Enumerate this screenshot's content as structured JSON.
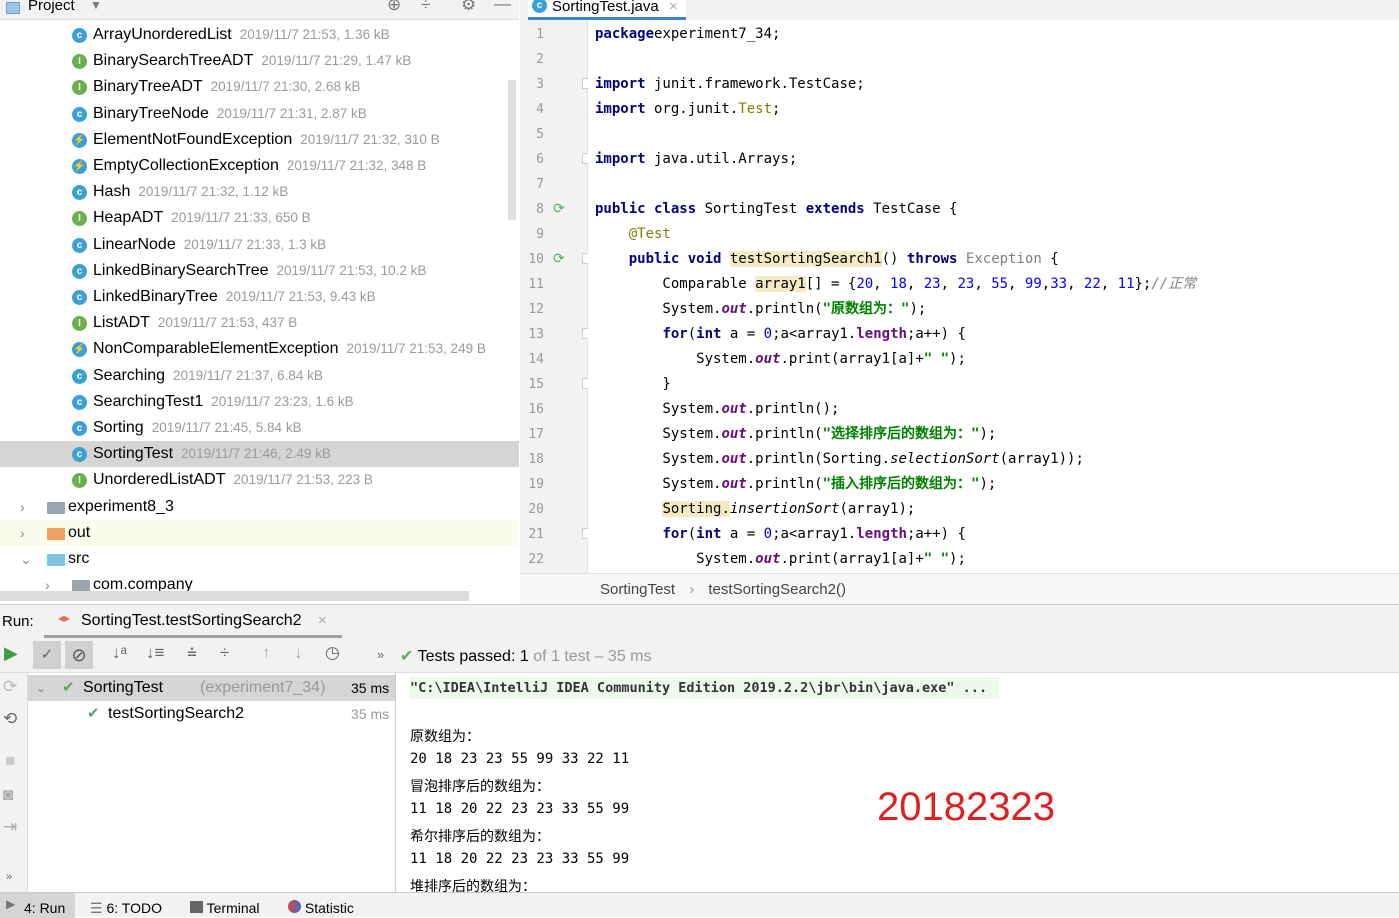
{
  "project": {
    "title": "Project",
    "files": [
      {
        "name": "ArrayUnorderedList",
        "meta": "2019/11/7 21:53, 1.36 kB",
        "type": "class"
      },
      {
        "name": "BinarySearchTreeADT",
        "meta": "2019/11/7 21:29, 1.47 kB",
        "type": "interface"
      },
      {
        "name": "BinaryTreeADT",
        "meta": "2019/11/7 21:30, 2.68 kB",
        "type": "interface"
      },
      {
        "name": "BinaryTreeNode",
        "meta": "2019/11/7 21:31, 2.87 kB",
        "type": "class"
      },
      {
        "name": "ElementNotFoundException",
        "meta": "2019/11/7 21:32, 310 B",
        "type": "exception"
      },
      {
        "name": "EmptyCollectionException",
        "meta": "2019/11/7 21:32, 348 B",
        "type": "exception"
      },
      {
        "name": "Hash",
        "meta": "2019/11/7 21:32, 1.12 kB",
        "type": "class"
      },
      {
        "name": "HeapADT",
        "meta": "2019/11/7 21:33, 650 B",
        "type": "interface"
      },
      {
        "name": "LinearNode",
        "meta": "2019/11/7 21:33, 1.3 kB",
        "type": "class"
      },
      {
        "name": "LinkedBinarySearchTree",
        "meta": "2019/11/7 21:53, 10.2 kB",
        "type": "class"
      },
      {
        "name": "LinkedBinaryTree",
        "meta": "2019/11/7 21:53, 9.43 kB",
        "type": "class"
      },
      {
        "name": "ListADT",
        "meta": "2019/11/7 21:53, 437 B",
        "type": "interface"
      },
      {
        "name": "NonComparableElementException",
        "meta": "2019/11/7 21:53, 249 B",
        "type": "exception"
      },
      {
        "name": "Searching",
        "meta": "2019/11/7 21:37, 6.84 kB",
        "type": "class"
      },
      {
        "name": "SearchingTest1",
        "meta": "2019/11/7 23:23, 1.6 kB",
        "type": "test"
      },
      {
        "name": "Sorting",
        "meta": "2019/11/7 21:45, 5.84 kB",
        "type": "class"
      },
      {
        "name": "SortingTest",
        "meta": "2019/11/7 21:46, 2.49 kB",
        "type": "test",
        "selected": true
      },
      {
        "name": "UnorderedListADT",
        "meta": "2019/11/7 21:53, 223 B",
        "type": "interface"
      }
    ],
    "folders": [
      {
        "name": "experiment8_3",
        "color": "#9aa7b0",
        "expanded": false
      },
      {
        "name": "out",
        "color": "#f0a060",
        "expanded": false
      },
      {
        "name": "src",
        "color": "#7ec3e6",
        "expanded": true
      },
      {
        "name": "com.company",
        "color": "#9aa7b0",
        "expanded": false
      }
    ]
  },
  "editor": {
    "tab": "SortingTest.java",
    "lines": [
      [
        [
          "kw",
          "package"
        ],
        [
          "",
          "experiment7_34;"
        ]
      ],
      [],
      [
        [
          "kw",
          "import"
        ],
        [
          "",
          " junit.framework.TestCase;"
        ]
      ],
      [
        [
          "kw",
          "import"
        ],
        [
          "",
          " org.junit."
        ],
        [
          "ann",
          "Test"
        ],
        [
          "",
          ";"
        ]
      ],
      [],
      [
        [
          "kw",
          "import"
        ],
        [
          "",
          " java.util.Arrays;"
        ]
      ],
      [],
      [
        [
          "kw",
          "public class"
        ],
        [
          "",
          " SortingTest "
        ],
        [
          "kw",
          "extends"
        ],
        [
          "",
          " TestCase {"
        ]
      ],
      [
        [
          "",
          "    "
        ],
        [
          "ann",
          "@Test"
        ]
      ],
      [
        [
          "",
          "    "
        ],
        [
          "kw",
          "public void"
        ],
        [
          "",
          " "
        ],
        [
          "hlb",
          "testSortingSearch1"
        ],
        [
          "",
          "() "
        ],
        [
          "kw",
          "throws"
        ],
        [
          "",
          " "
        ],
        [
          "gr",
          "Exception"
        ],
        [
          "",
          " {"
        ]
      ],
      [
        [
          "",
          "        Comparable "
        ],
        [
          "hlb",
          "array1"
        ],
        [
          "",
          "[] = {"
        ],
        [
          "num",
          "20"
        ],
        [
          "",
          ", "
        ],
        [
          "num",
          "18"
        ],
        [
          "",
          ", "
        ],
        [
          "num",
          "23"
        ],
        [
          "",
          ", "
        ],
        [
          "num",
          "23"
        ],
        [
          "",
          ", "
        ],
        [
          "num",
          "55"
        ],
        [
          "",
          ", "
        ],
        [
          "num",
          "99"
        ],
        [
          "",
          ","
        ],
        [
          "num",
          "33"
        ],
        [
          "",
          ", "
        ],
        [
          "num",
          "22"
        ],
        [
          "",
          ", "
        ],
        [
          "num",
          "11"
        ],
        [
          "",
          "};"
        ],
        [
          "cmt",
          "//正常"
        ]
      ],
      [
        [
          "",
          "        System."
        ],
        [
          "fld",
          "out"
        ],
        [
          "",
          ".println("
        ],
        [
          "str",
          "\"原数组为：\""
        ],
        [
          "",
          ");"
        ]
      ],
      [
        [
          "",
          "        "
        ],
        [
          "kw",
          "for"
        ],
        [
          "",
          "("
        ],
        [
          "kw",
          "int"
        ],
        [
          "",
          " a = "
        ],
        [
          "num",
          "0"
        ],
        [
          "",
          ";a<array1."
        ],
        [
          "lenf",
          "length"
        ],
        [
          "",
          ";a++) {"
        ]
      ],
      [
        [
          "",
          "            System."
        ],
        [
          "fld",
          "out"
        ],
        [
          "",
          ".print(array1[a]+"
        ],
        [
          "str",
          "\" \""
        ],
        [
          "",
          ");"
        ]
      ],
      [
        [
          "",
          "        }"
        ]
      ],
      [
        [
          "",
          "        System."
        ],
        [
          "fld",
          "out"
        ],
        [
          "",
          ".println();"
        ]
      ],
      [
        [
          "",
          "        System."
        ],
        [
          "fld",
          "out"
        ],
        [
          "",
          ".println("
        ],
        [
          "str",
          "\"选择排序后的数组为：\""
        ],
        [
          "",
          ");"
        ]
      ],
      [
        [
          "",
          "        System."
        ],
        [
          "fld",
          "out"
        ],
        [
          "",
          ".println(Sorting."
        ],
        [
          "st",
          "selectionSort"
        ],
        [
          "",
          "(array1));"
        ]
      ],
      [
        [
          "",
          "        System."
        ],
        [
          "fld",
          "out"
        ],
        [
          "",
          ".println("
        ],
        [
          "str",
          "\"插入排序后的数组为：\""
        ],
        [
          "",
          ");"
        ]
      ],
      [
        [
          "",
          "        "
        ],
        [
          "hlb",
          "Sorting."
        ],
        [
          "st",
          "insertionSort"
        ],
        [
          "",
          "(array1);"
        ]
      ],
      [
        [
          "",
          "        "
        ],
        [
          "kw",
          "for"
        ],
        [
          "",
          "("
        ],
        [
          "kw",
          "int"
        ],
        [
          "",
          " a = "
        ],
        [
          "num",
          "0"
        ],
        [
          "",
          ";a<array1."
        ],
        [
          "lenf",
          "length"
        ],
        [
          "",
          ";a++) {"
        ]
      ],
      [
        [
          "",
          "            System."
        ],
        [
          "fld",
          "out"
        ],
        [
          "",
          ".print(array1[a]+"
        ],
        [
          "str",
          "\" \""
        ],
        [
          "",
          ");"
        ]
      ]
    ],
    "breadcrumbs": [
      "SortingTest",
      "testSortingSearch2()"
    ]
  },
  "run": {
    "label": "Run:",
    "tab": "SortingTest.testSortingSearch2",
    "status_prefix": "Tests passed:",
    "status_count": "1",
    "status_rest": "of 1 test – 35 ms",
    "tree": [
      {
        "name": "SortingTest",
        "detail": "(experiment7_34)",
        "time": "35 ms"
      },
      {
        "name": "testSortingSearch2",
        "time": "35 ms"
      }
    ],
    "console": {
      "command": "\"C:\\IDEA\\IntelliJ IDEA Community Edition 2019.2.2\\jbr\\bin\\java.exe\" ...",
      "lines": [
        "原数组为：",
        "20 18 23 23 55 99 33 22 11",
        "冒泡排序后的数组为：",
        "11 18 20 22 23 23 33 55 99",
        "希尔排序后的数组为：",
        "11 18 20 22 23 23 33 55 99",
        "堆排序后的数组为："
      ],
      "watermark": "20182323"
    }
  },
  "bottom": {
    "tabs": [
      "4: Run",
      "6: TODO",
      "Terminal",
      "Statistic"
    ]
  },
  "colors": {
    "accent": "#4083c9",
    "pass": "#59a869",
    "watermark": "#e02020"
  }
}
